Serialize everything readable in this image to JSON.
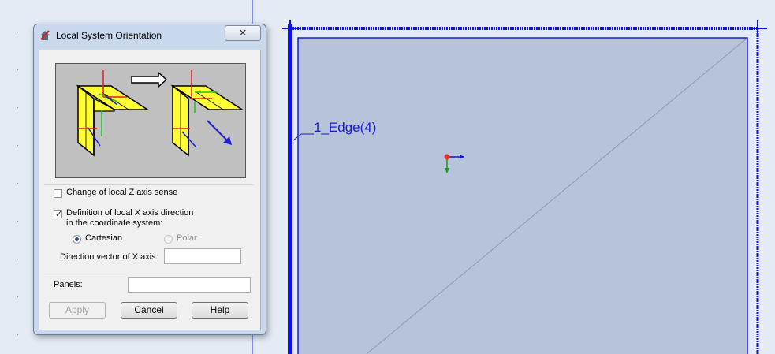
{
  "dialog": {
    "title": "Local System Orientation",
    "close_label": "✕",
    "change_z_label": "Change of local Z axis sense",
    "change_z_checked": false,
    "definition_x_label_line1": "Definition of local X axis direction",
    "definition_x_label_line2": "in the coordinate system:",
    "definition_x_checked": true,
    "cartesian_label": "Cartesian",
    "polar_label": "Polar",
    "direction_vector_label": "Direction vector of X axis:",
    "direction_vector_value": "",
    "panels_label": "Panels:",
    "panels_value": "",
    "apply_label": "Apply",
    "cancel_label": "Cancel",
    "help_label": "Help"
  },
  "viewport": {
    "edge_label": "1_Edge(4)"
  },
  "colors": {
    "accent_blue": "#1a1ae0",
    "panel_fill": "#b7c3d8",
    "illustration_yellow": "#ffff33"
  }
}
